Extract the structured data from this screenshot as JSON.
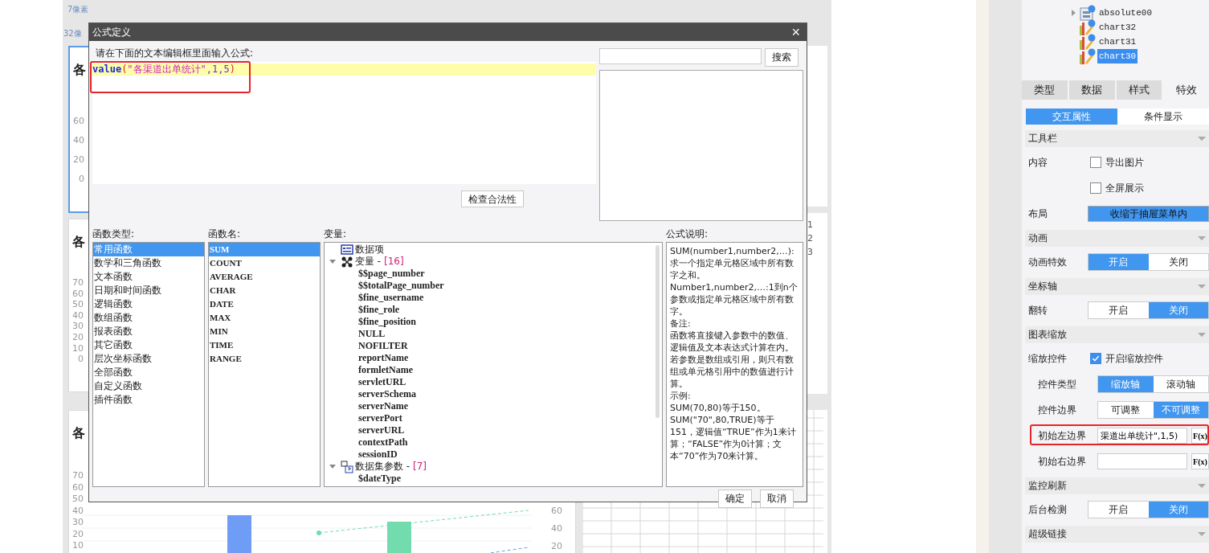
{
  "canvas": {
    "spacing_labels": [
      "7像素",
      "32像"
    ],
    "left_cards": [
      {
        "title": "各",
        "selected": true,
        "ticks": [
          "60",
          "40",
          "20",
          "0"
        ]
      },
      {
        "title": "各",
        "selected": false,
        "ticks": [
          "70",
          "60",
          "50",
          "40",
          "30",
          "20",
          "10",
          "0"
        ]
      },
      {
        "title": "各",
        "selected": false,
        "ticks": [
          "70",
          "60",
          "50",
          "40",
          "30",
          "20",
          "10"
        ],
        "right_ticks": [
          "60",
          "40",
          "20"
        ],
        "kind": "bar-line"
      }
    ],
    "row_numbers": [
      "1",
      "2",
      "3"
    ]
  },
  "dialog": {
    "title": "公式定义",
    "close": "×",
    "prompt": "请在下面的文本编辑框里面输入公式:",
    "editor_highlighted": true,
    "formula_tokens": [
      {
        "text": "value",
        "kind": "function"
      },
      {
        "text": "(",
        "kind": "paren"
      },
      {
        "text": "\"各渠道出单统计\"",
        "kind": "string"
      },
      {
        "text": ",1,5",
        "kind": "number"
      },
      {
        "text": ")",
        "kind": "paren"
      }
    ],
    "check_button": "检查合法性",
    "search_button": "搜索",
    "labels": [
      "函数类型:",
      "函数名:",
      "变量:",
      "公式说明:"
    ],
    "function_types": [
      {
        "label": "常用函数",
        "selected": true
      },
      {
        "label": "数学和三角函数",
        "selected": false
      },
      {
        "label": "文本函数",
        "selected": false
      },
      {
        "label": "日期和时间函数",
        "selected": false
      },
      {
        "label": "逻辑函数",
        "selected": false
      },
      {
        "label": "数组函数",
        "selected": false
      },
      {
        "label": "报表函数",
        "selected": false
      },
      {
        "label": "其它函数",
        "selected": false
      },
      {
        "label": "层次坐标函数",
        "selected": false
      },
      {
        "label": "全部函数",
        "selected": false
      },
      {
        "label": "自定义函数",
        "selected": false
      },
      {
        "label": "插件函数",
        "selected": false
      }
    ],
    "function_names": [
      {
        "label": "SUM",
        "selected": true
      },
      {
        "label": "COUNT",
        "selected": false
      },
      {
        "label": "AVERAGE",
        "selected": false
      },
      {
        "label": "CHAR",
        "selected": false
      },
      {
        "label": "DATE",
        "selected": false
      },
      {
        "label": "MAX",
        "selected": false
      },
      {
        "label": "MIN",
        "selected": false
      },
      {
        "label": "TIME",
        "selected": false
      },
      {
        "label": "RANGE",
        "selected": false
      }
    ],
    "variables": [
      {
        "label": "数据项",
        "kind": "dataitem"
      },
      {
        "label": "变量 -",
        "count": "[16]",
        "kind": "variables",
        "expanded": true,
        "children": [
          {
            "label": "$$page_number"
          },
          {
            "label": "$$totalPage_number"
          },
          {
            "label": "$fine_username"
          },
          {
            "label": "$fine_role"
          },
          {
            "label": "$fine_position"
          },
          {
            "label": "NULL"
          },
          {
            "label": "NOFILTER"
          },
          {
            "label": "reportName"
          },
          {
            "label": "formletName"
          },
          {
            "label": "servletURL"
          },
          {
            "label": "serverSchema"
          },
          {
            "label": "serverName"
          },
          {
            "label": "serverPort"
          },
          {
            "label": "serverURL"
          },
          {
            "label": "contextPath"
          },
          {
            "label": "sessionID"
          }
        ]
      },
      {
        "label": "数据集参数 -",
        "count": "[7]",
        "kind": "parameters",
        "expanded": true,
        "children": [
          {
            "label": "$dateType"
          }
        ]
      }
    ],
    "description": [
      "SUM(number1,number2,…):求一个指定单元格区域中所有数字之和。",
      "Number1,number2,…:1到n个参数或指定单元格区域中所有数字。",
      "备注:",
      "函数将直接键入参数中的数值、逻辑值及文本表达式计算在内。若参数是数组或引用，则只有数组或单元格引用中的数值进行计算。",
      "示例:",
      "SUM(70,80)等于150。",
      "SUM(\"70\",80,TRUE)等于151，逻辑值“TRUE”作为1来计算；“FALSE”作为0计算；文本“70”作为70来计算。"
    ],
    "buttons": [
      "确定",
      "取消"
    ]
  },
  "panel": {
    "tree": [
      {
        "label": "absolute00",
        "kind": "layout",
        "expanded": false,
        "selected": false
      },
      {
        "label": "chart32",
        "kind": "chart",
        "selected": false
      },
      {
        "label": "chart31",
        "kind": "chart",
        "selected": false
      },
      {
        "label": "chart30",
        "kind": "chart",
        "selected": true
      }
    ],
    "tabs": [
      {
        "label": "类型",
        "selected": false
      },
      {
        "label": "数据",
        "selected": false
      },
      {
        "label": "样式",
        "selected": false
      },
      {
        "label": "特效",
        "selected": true
      }
    ],
    "subtabs": [
      {
        "label": "交互属性",
        "selected": true
      },
      {
        "label": "条件显示",
        "selected": false
      }
    ],
    "sections": [
      {
        "title": "工具栏",
        "rows": [
          {
            "kind": "checkbox",
            "label": "内容",
            "option": "导出图片",
            "checked": false
          },
          {
            "kind": "checkbox",
            "option": "全屏展示",
            "checked": false
          },
          {
            "kind": "select",
            "label": "布局",
            "value": "收缩于抽屉菜单内"
          }
        ]
      },
      {
        "title": "动画",
        "rows": [
          {
            "kind": "segmented",
            "label": "动画特效",
            "options": [
              {
                "label": "开启",
                "selected": true
              },
              {
                "label": "关闭",
                "selected": false
              }
            ]
          }
        ]
      },
      {
        "title": "坐标轴",
        "rows": [
          {
            "kind": "segmented",
            "label": "翻转",
            "options": [
              {
                "label": "开启",
                "selected": false
              },
              {
                "label": "关闭",
                "selected": true
              }
            ]
          }
        ]
      },
      {
        "title": "图表缩放",
        "rows": [
          {
            "kind": "checkbox",
            "label": "缩放控件",
            "option": "开启缩放控件",
            "checked": true,
            "children": [
              {
                "kind": "segmented",
                "label": "控件类型",
                "options": [
                  {
                    "label": "缩放轴",
                    "selected": true
                  },
                  {
                    "label": "滚动轴",
                    "selected": false
                  }
                ]
              },
              {
                "kind": "segmented",
                "label": "控件边界",
                "options": [
                  {
                    "label": "可调整",
                    "selected": false
                  },
                  {
                    "label": "不可调整",
                    "selected": true
                  }
                ]
              },
              {
                "kind": "formula",
                "label": "初始左边界",
                "value": "渠道出单统计\",1,5)",
                "button": "F(x)",
                "highlighted": true
              },
              {
                "kind": "formula",
                "label": "初始右边界",
                "button": "F(x)",
                "highlighted": false
              }
            ]
          }
        ]
      },
      {
        "title": "监控刷新",
        "rows": [
          {
            "kind": "segmented",
            "label": "后台检测",
            "options": [
              {
                "label": "开启",
                "selected": false
              },
              {
                "label": "关闭",
                "selected": true
              }
            ]
          }
        ]
      },
      {
        "title": "超级链接"
      }
    ]
  }
}
